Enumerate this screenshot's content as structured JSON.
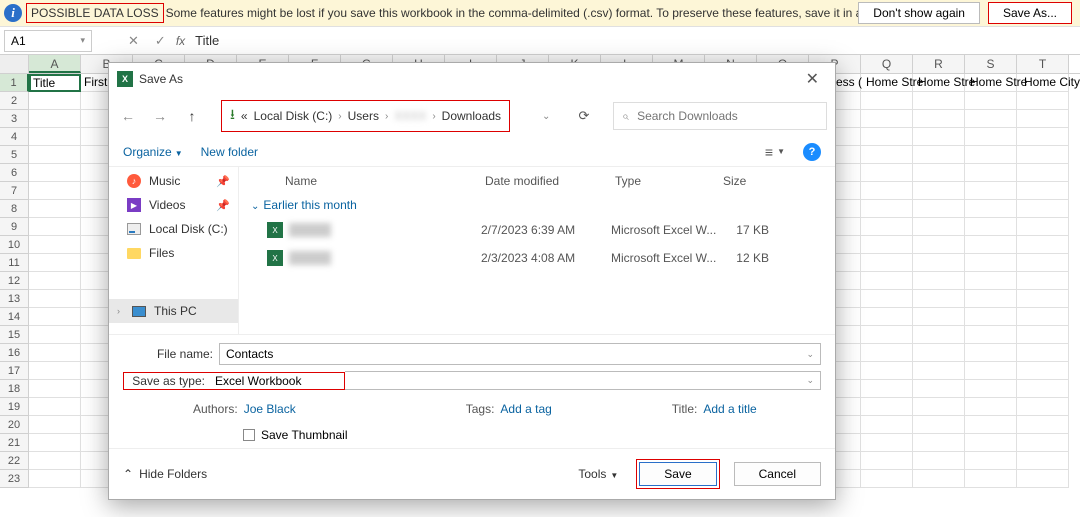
{
  "warning": {
    "title": "POSSIBLE DATA LOSS",
    "text": "Some features might be lost if you save this workbook in the comma-delimited (.csv) format. To preserve these features, save it in an Excel file format.",
    "dont_show": "Don't show again",
    "save_as": "Save As..."
  },
  "namebox": "A1",
  "formula_value": "Title",
  "columns": [
    "A",
    "B",
    "C",
    "D",
    "E",
    "F",
    "G",
    "H",
    "I",
    "J",
    "K",
    "L",
    "M",
    "N",
    "O",
    "P",
    "Q",
    "R",
    "S",
    "T"
  ],
  "row1_cells": {
    "A": "Title",
    "B": "First"
  },
  "far_headers": [
    "ess (",
    "Home Stre",
    "Home Stre",
    "Home Stre",
    "Home City"
  ],
  "dialog": {
    "title": "Save As",
    "breadcrumb": {
      "prefix": "«",
      "c": "Local Disk (C:)",
      "u": "Users",
      "d": "Downloads"
    },
    "search_placeholder": "Search Downloads",
    "organize": "Organize",
    "new_folder": "New folder",
    "sidebar": {
      "music": "Music",
      "videos": "Videos",
      "disk": "Local Disk (C:)",
      "files": "Files",
      "thispc": "This PC"
    },
    "headers": {
      "name": "Name",
      "date": "Date modified",
      "type": "Type",
      "size": "Size"
    },
    "group": "Earlier this month",
    "files": [
      {
        "date": "2/7/2023 6:39 AM",
        "type": "Microsoft Excel W...",
        "size": "17 KB"
      },
      {
        "date": "2/3/2023 4:08 AM",
        "type": "Microsoft Excel W...",
        "size": "12 KB"
      }
    ],
    "file_name_label": "File name:",
    "file_name": "Contacts",
    "save_type_label": "Save as type:",
    "save_type": "Excel Workbook",
    "authors_label": "Authors:",
    "authors": "Joe Black",
    "tags_label": "Tags:",
    "tags": "Add a tag",
    "titlemeta_label": "Title:",
    "titlemeta": "Add a title",
    "save_thumb": "Save Thumbnail",
    "hide_folders": "Hide Folders",
    "tools": "Tools",
    "save": "Save",
    "cancel": "Cancel"
  }
}
